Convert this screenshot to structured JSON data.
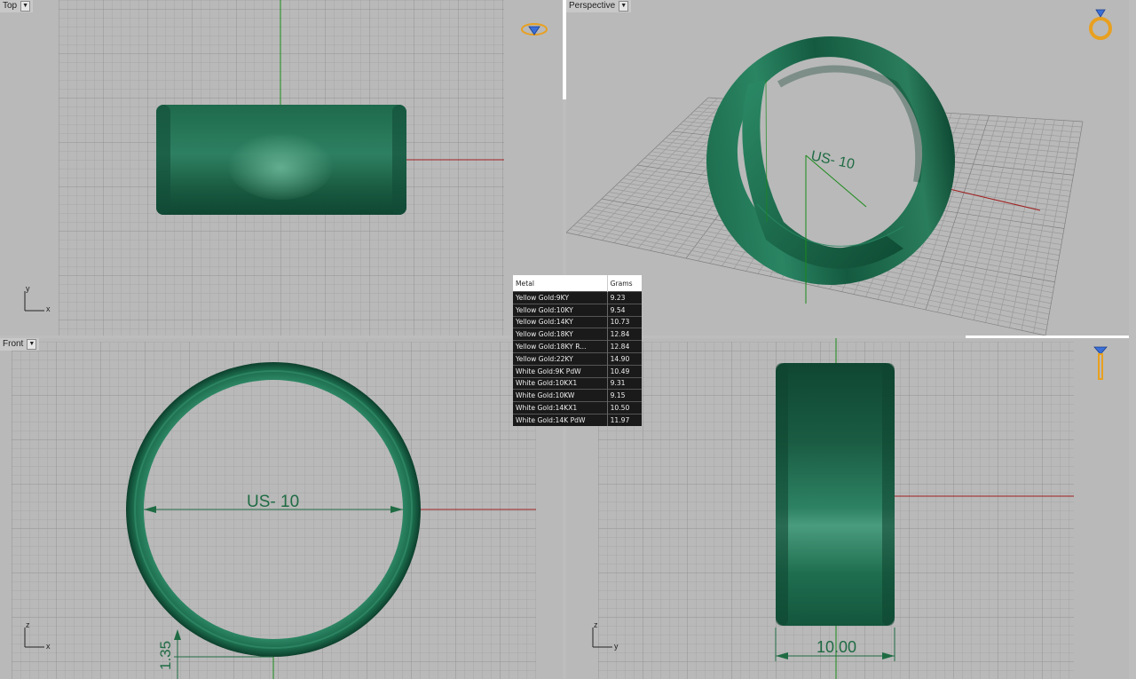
{
  "viewports": {
    "top": {
      "label": "Top",
      "axes": {
        "a": "y",
        "b": "x"
      }
    },
    "perspective": {
      "label": "Perspective",
      "dimension_text": "US- 10"
    },
    "front": {
      "label": "Front",
      "axes": {
        "a": "z",
        "b": "x"
      },
      "dimension_text": "US- 10",
      "thickness_text": "1.35"
    },
    "right": {
      "axes": {
        "a": "z",
        "b": "y"
      },
      "width_text": "10.00"
    }
  },
  "metal_table": {
    "headers": [
      "Metal",
      "Grams"
    ],
    "rows": [
      [
        "Yellow Gold:9KY",
        "9.23"
      ],
      [
        "Yellow Gold:10KY",
        "9.54"
      ],
      [
        "Yellow Gold:14KY",
        "10.73"
      ],
      [
        "Yellow Gold:18KY",
        "12.84"
      ],
      [
        "Yellow Gold:18KY R...",
        "12.84"
      ],
      [
        "Yellow Gold:22KY",
        "14.90"
      ],
      [
        "White Gold:9K PdW",
        "10.49"
      ],
      [
        "White Gold:10KX1",
        "9.31"
      ],
      [
        "White Gold:10KW",
        "9.15"
      ],
      [
        "White Gold:14KX1",
        "10.50"
      ],
      [
        "White Gold:14K PdW",
        "11.97"
      ]
    ]
  },
  "colors": {
    "viewport_bg": "#b9b9b9",
    "grid_minor": "#a5a5a5",
    "grid_major": "#8f8f8f",
    "ring_dark": "#0f4a34",
    "ring_mid": "#1f7a55",
    "ring_light": "#5fae8e",
    "axis_x": "#a02020",
    "axis_y": "#1a8a1a",
    "icon_gold": "#e8a020",
    "icon_blue": "#3a6fd8"
  }
}
